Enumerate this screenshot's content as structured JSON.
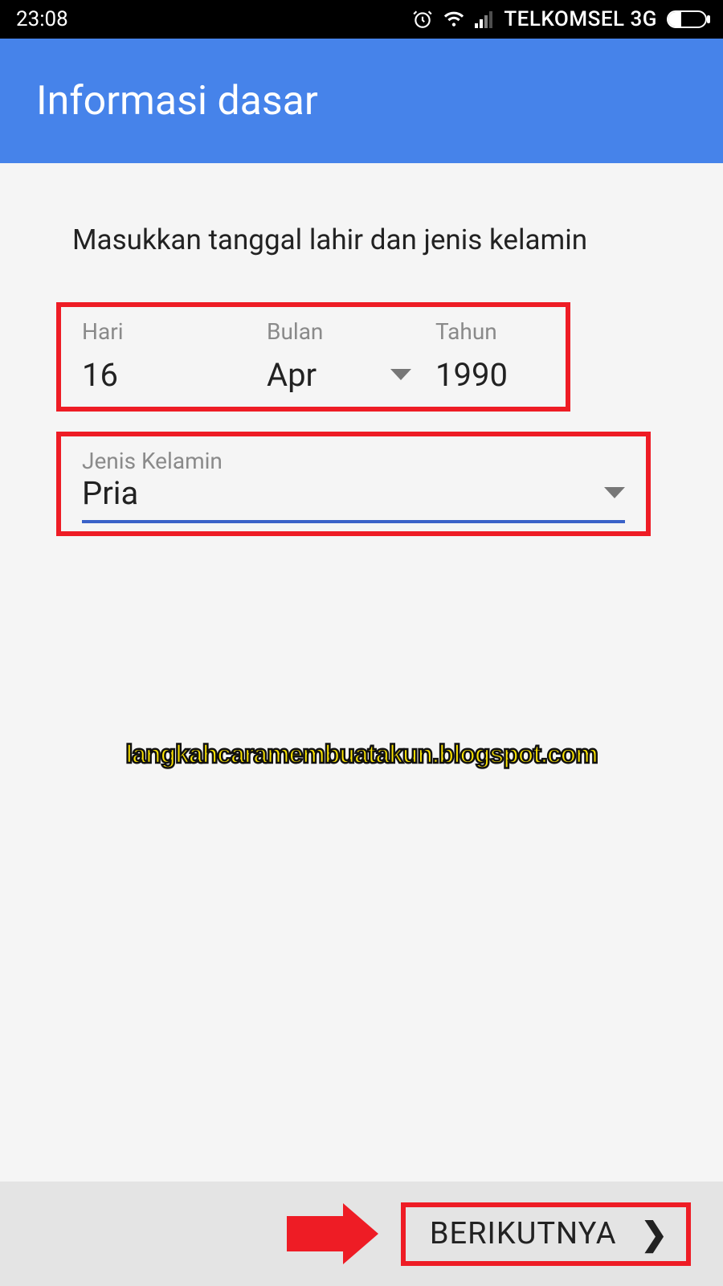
{
  "status": {
    "time": "23:08",
    "carrier": "TELKOMSEL 3G"
  },
  "header": {
    "title": "Informasi dasar"
  },
  "form": {
    "instruction": "Masukkan tanggal lahir dan jenis kelamin",
    "date": {
      "day_label": "Hari",
      "day_value": "16",
      "month_label": "Bulan",
      "month_value": "Apr",
      "year_label": "Tahun",
      "year_value": "1990"
    },
    "gender": {
      "label": "Jenis Kelamin",
      "value": "Pria"
    }
  },
  "watermark": "langkahcaramembuatakun.blogspot.com",
  "footer": {
    "next_label": "BERIKUTNYA"
  }
}
